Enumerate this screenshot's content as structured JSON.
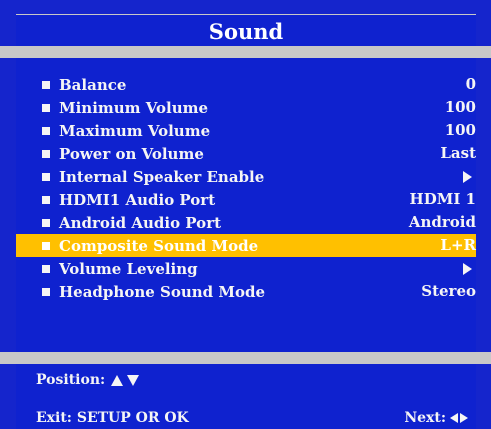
{
  "title": "Sound",
  "colors": {
    "panel": "#0f22cf",
    "frame": "#1525cc",
    "highlight": "#ffc000",
    "separator": "#c8c8c8",
    "text": "#f5f5f5"
  },
  "menu": {
    "selected_index": 7,
    "items": [
      {
        "label": "Balance",
        "value": "0"
      },
      {
        "label": "Minimum Volume",
        "value": "100"
      },
      {
        "label": "Maximum Volume",
        "value": "100"
      },
      {
        "label": "Power on Volume",
        "value": "Last"
      },
      {
        "label": "Internal Speaker Enable",
        "value": "",
        "icon": "submenu-arrow-icon"
      },
      {
        "label": "HDMI1 Audio Port",
        "value": "HDMI 1"
      },
      {
        "label": "Android Audio Port",
        "value": "Android"
      },
      {
        "label": "Composite Sound Mode",
        "value": "L+R"
      },
      {
        "label": "Volume Leveling",
        "value": "",
        "icon": "submenu-arrow-icon"
      },
      {
        "label": "Headphone Sound Mode",
        "value": "Stereo"
      }
    ]
  },
  "footer": {
    "position_label": "Position:",
    "exit_label": "Exit:  SETUP OR OK",
    "next_label": "Next:"
  }
}
